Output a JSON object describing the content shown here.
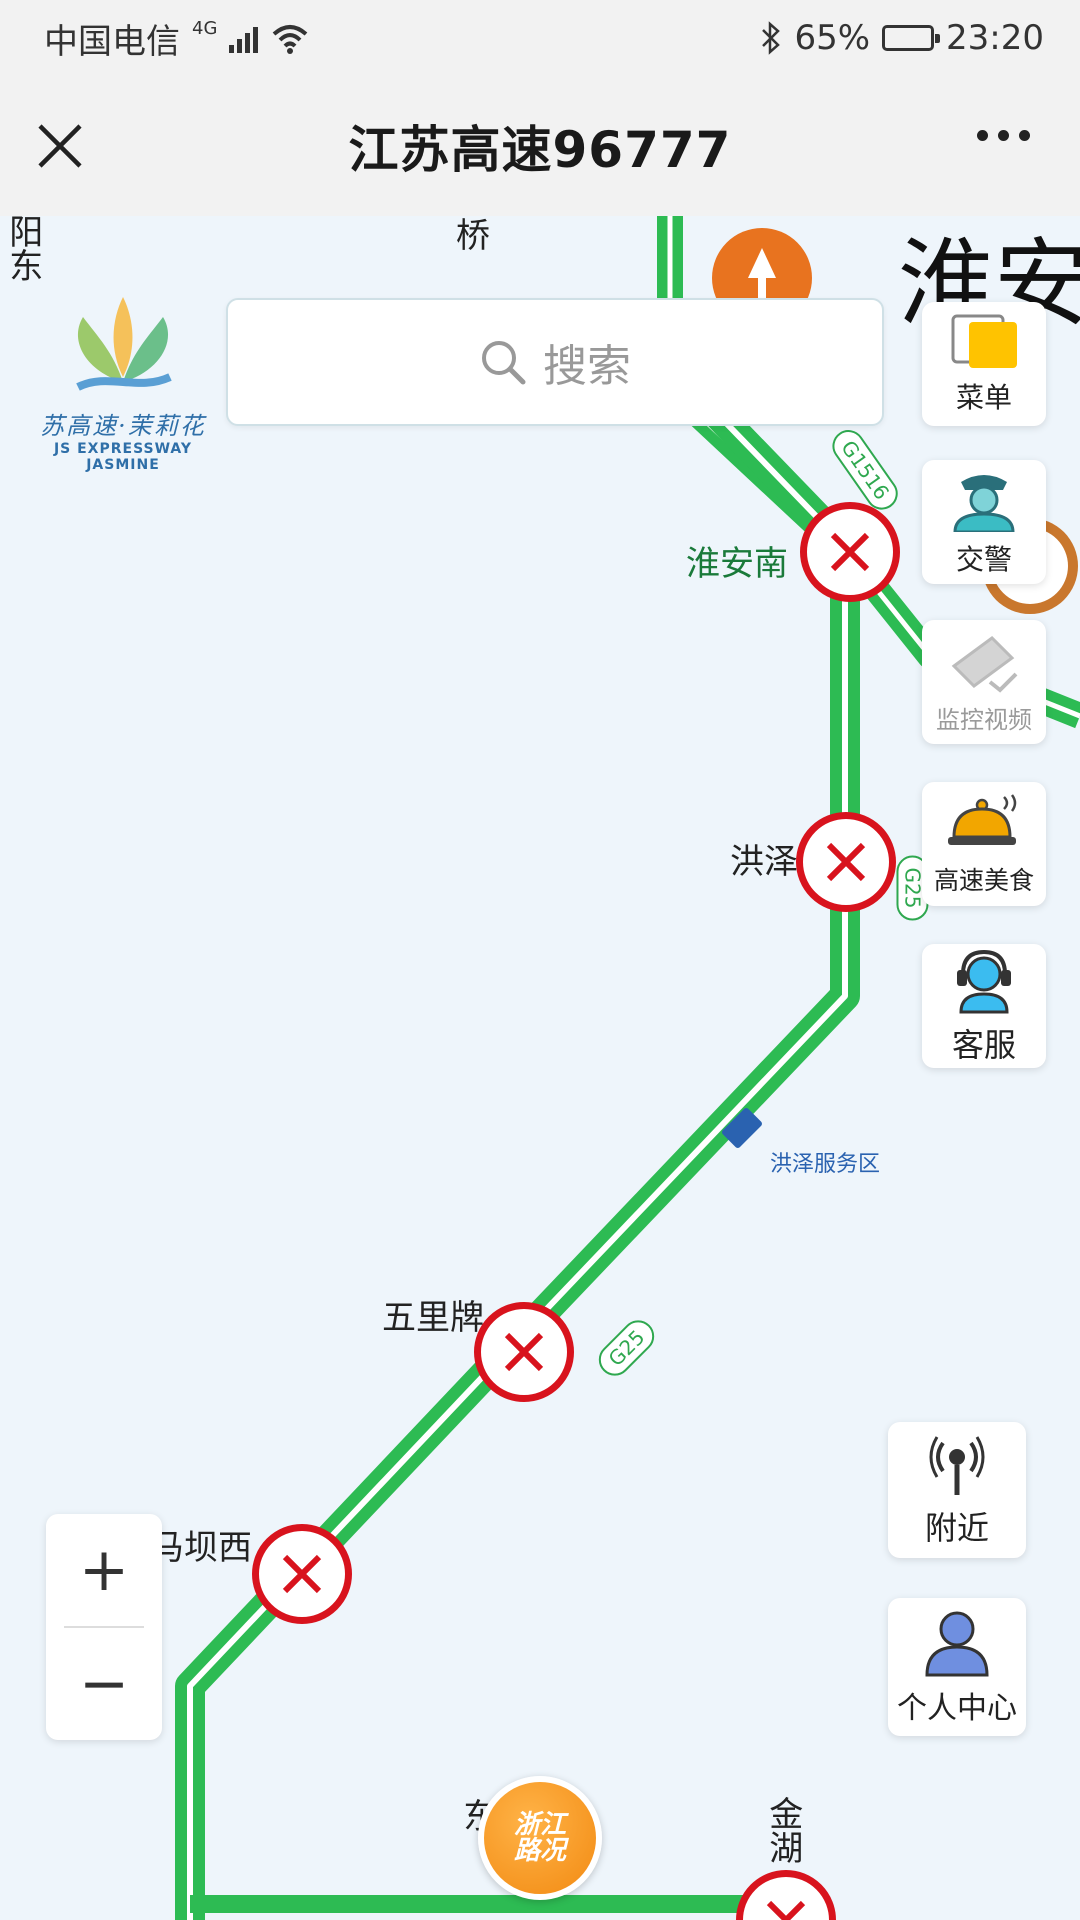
{
  "status_bar": {
    "carrier": "中国电信",
    "network": "4G",
    "battery_percent": "65%",
    "battery_level": 0.65,
    "time": "23:20"
  },
  "title_bar": {
    "title": "江苏高速96777"
  },
  "search": {
    "placeholder": "搜索"
  },
  "logo": {
    "cn": "苏高速·茉莉花",
    "en": "JS EXPRESSWAY JASMINE"
  },
  "side_menu": [
    {
      "label": "菜单",
      "icon": "menu-icon"
    },
    {
      "label": "交警",
      "icon": "traffic-police-icon"
    },
    {
      "label": "监控视频",
      "icon": "camera-icon"
    },
    {
      "label": "高速美食",
      "icon": "food-cloche-icon"
    },
    {
      "label": "客服",
      "icon": "customer-service-icon"
    }
  ],
  "bottom_side_menu": [
    {
      "label": "附近",
      "icon": "nearby-signal-icon"
    },
    {
      "label": "个人中心",
      "icon": "user-icon"
    }
  ],
  "map": {
    "places": {
      "yangdong": "阳东",
      "qiao": "桥",
      "huaian": "淮安",
      "huaian_nan": "淮安南",
      "hongze": "洪泽",
      "hongze_service": "洪泽服务区",
      "wulipai": "五里牌",
      "mabaxi": "马坝西",
      "dong": "东",
      "jinhu": "金湖"
    },
    "road_labels": {
      "g1516": "G1516",
      "g25_a": "G25",
      "g25_b": "G25"
    },
    "closure_icon": "closed-x-icon",
    "colors": {
      "road_green": "#2dbb53",
      "closure_red": "#d8131d",
      "map_bg": "#eef5fb"
    }
  },
  "zoom": {
    "in_label": "+",
    "out_label": "−"
  },
  "fab": {
    "label": "浙江路况"
  }
}
